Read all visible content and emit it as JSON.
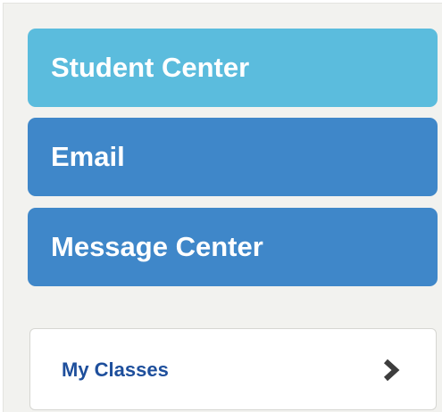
{
  "nav": {
    "student_center": "Student Center",
    "email": "Email",
    "message_center": "Message Center"
  },
  "classes": {
    "label": "My Classes",
    "icon": "chevron-right-icon"
  },
  "colors": {
    "student_center_bg": "#5bbcdd",
    "nav_button_bg": "#3f87c9",
    "classes_text": "#1e4f9c",
    "chevron": "#3d3d3d",
    "panel_bg": "#f2f2ef"
  }
}
